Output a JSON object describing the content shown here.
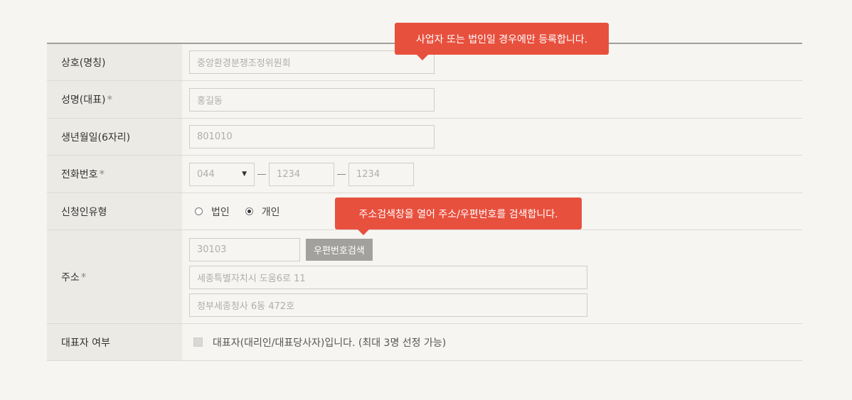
{
  "rows": {
    "business_name": {
      "label": "상호(명칭)",
      "placeholder": "중앙환경분쟁조정위원회"
    },
    "name": {
      "label": "성명(대표)",
      "star": "*",
      "placeholder": "홍길동"
    },
    "birth": {
      "label": "생년월일(6자리)",
      "placeholder": "801010"
    },
    "phone": {
      "label": "전화번호",
      "star": "*",
      "area_code": "044",
      "select_arrow": "▼",
      "mid": "1234",
      "last": "1234"
    },
    "applicant_type": {
      "label": "신청인유형",
      "options": [
        "법인",
        "개인"
      ],
      "selected": "개인"
    },
    "address": {
      "label": "주소",
      "star": "*",
      "zip": "30103",
      "zip_button": "우편번호검색",
      "line1": "세종특별자치시 도움6로 11",
      "line2": "정부세종청사 6동 472호"
    },
    "representative": {
      "label": "대표자 여부",
      "checkbox_label": "대표자(대리인/대표당사자)입니다. (최대 3명 선정 가능)",
      "checked": false
    }
  },
  "tooltips": {
    "business": "사업자 또는 법인일 경우에만 등록합니다.",
    "address": "주소검색창을 열어 주소/우편번호를 검색합니다."
  },
  "colors": {
    "accent": "#e8503e",
    "label_bg": "#ebeae5",
    "page_bg": "#f6f5f1",
    "button_gray": "#a3a19d"
  }
}
